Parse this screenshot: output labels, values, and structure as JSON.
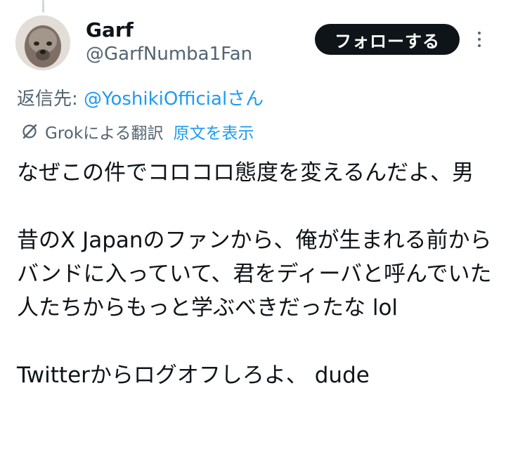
{
  "tweet": {
    "author": {
      "display_name": "Garf",
      "handle": "@GarfNumba1Fan"
    },
    "follow_label": "フォローする",
    "reply_prefix": "返信先: ",
    "reply_to": "@YoshikiOfficialさん",
    "translation": {
      "label": "Grokによる翻訳",
      "show_original": "原文を表示"
    },
    "text": {
      "p1": "なぜこの件でコロコロ態度を変えるんだよ、男",
      "p2": "昔のX Japanのファンから、俺が生まれる前からバンドに入っていて、君をディーバと呼んでいた人たちからもっと学ぶべきだったな lol",
      "p3": "Twitterからログオフしろよ、 dude"
    }
  },
  "colors": {
    "text_primary": "#0f1419",
    "text_secondary": "#536471",
    "link": "#1d9bf0",
    "button_bg": "#0f1419",
    "thread_line": "#cfd9de"
  },
  "icons": {
    "translate": "grok-translate-icon",
    "more": "more-icon"
  }
}
